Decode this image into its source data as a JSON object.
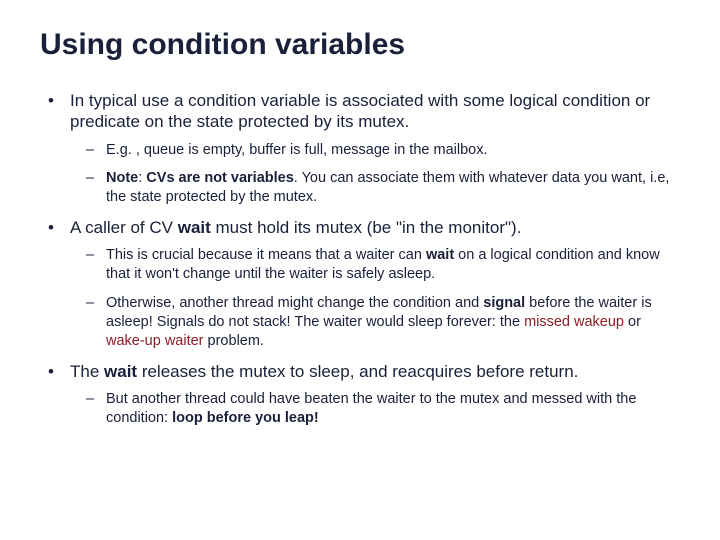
{
  "title": "Using condition variables",
  "p1": {
    "text": "In typical use a condition variable is associated with some logical condition or predicate on the state protected by its mutex.",
    "s1": "E.g. , queue is empty, buffer is full, message in the mailbox.",
    "s2a": "Note",
    "s2b": ": ",
    "s2c": "CVs are not variables",
    "s2d": ". You can associate them with whatever data you want, i.e, the state protected by the mutex."
  },
  "p2": {
    "a": "A caller of CV ",
    "b": "wait",
    "c": " must hold its mutex (be \"in the monitor\").",
    "s1a": "This is crucial because it means that a waiter can ",
    "s1b": "wait",
    "s1c": " on a logical condition and know that it won't change until the waiter is safely asleep.",
    "s2a": "Otherwise, another thread might change the condition and ",
    "s2b": "signal",
    "s2c": " before the waiter is asleep!  Signals do not stack! The waiter would sleep forever: the ",
    "s2d": "missed wakeup",
    "s2e": " or ",
    "s2f": "wake-up waiter",
    "s2g": " problem."
  },
  "p3": {
    "a": "The ",
    "b": "wait",
    "c": " releases the mutex to sleep, and reacquires before return.",
    "s1a": "But another thread could have beaten the waiter to the mutex and messed with the condition: ",
    "s1b": "loop before you leap!"
  }
}
